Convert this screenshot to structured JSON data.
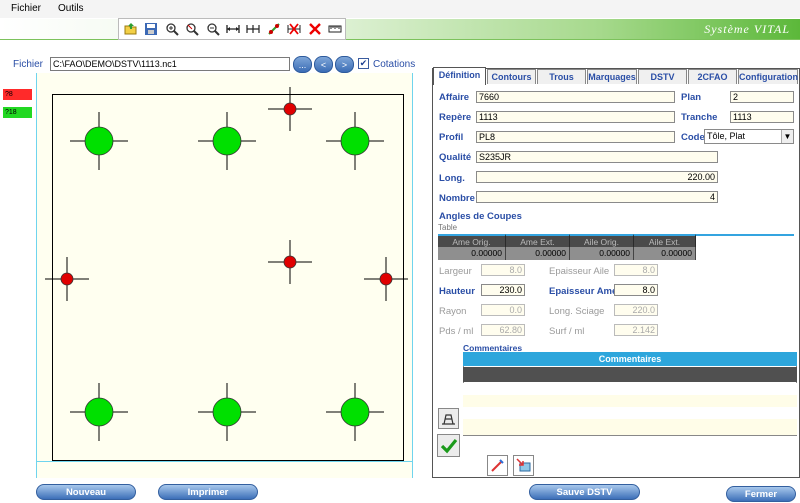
{
  "menubar": {
    "items": [
      "Fichier",
      "Outils"
    ]
  },
  "app_title": "Système VITAL",
  "toolbar": {
    "icons": [
      "folder-open-icon",
      "save-icon",
      "zoom-in-icon",
      "zoom-select-icon",
      "zoom-out-icon",
      "dimension-h-icon",
      "dimension-hh-icon",
      "add-point-icon",
      "delete-dimension-icon",
      "measure-icon"
    ]
  },
  "file": {
    "label": "Fichier",
    "path": "C:\\FAO\\DEMO\\DSTV\\1113.nc1",
    "browse_label": "...",
    "prev_label": "<",
    "next_label": ">"
  },
  "cotations": {
    "label": "Cotations",
    "checked": true,
    "check_glyph": "✔"
  },
  "left_badges": [
    {
      "text": "?8",
      "color": "#ff2a2a"
    },
    {
      "text": "?18",
      "color": "#22d822"
    }
  ],
  "drawing": {
    "holes_large_color": "#00e000",
    "holes_small_color": "#e00000"
  },
  "tabs": [
    "Définition",
    "Contours",
    "Trous",
    "Marquages",
    "DSTV",
    "2CFAO",
    "Configuration"
  ],
  "active_tab": "Définition",
  "form": {
    "affaire": {
      "label": "Affaire",
      "value": "7660"
    },
    "plan": {
      "label": "Plan",
      "value": "2"
    },
    "repere": {
      "label": "Repère",
      "value": "1113"
    },
    "tranche": {
      "label": "Tranche",
      "value": "1113"
    },
    "profil": {
      "label": "Profil",
      "value": "PL8"
    },
    "code": {
      "label": "Code",
      "value": "Tôle, Plat",
      "arrow": "▼"
    },
    "qualite": {
      "label": "Qualité",
      "value": "S235JR"
    },
    "long": {
      "label": "Long.",
      "value": "220.00"
    },
    "nombre": {
      "label": "Nombre",
      "value": "4"
    },
    "angles_title": "Angles de Coupes",
    "table_caption": "Table",
    "angles_headers": [
      "Ame Orig.",
      "Ame Ext.",
      "Aile Orig.",
      "Aile Ext."
    ],
    "angles_values": [
      "0.00000",
      "0.00000",
      "0.00000",
      "0.00000"
    ],
    "largeur": {
      "label": "Largeur",
      "value": "8.0"
    },
    "ep_aile": {
      "label": "Epaisseur Aile",
      "value": "8.0"
    },
    "hauteur": {
      "label": "Hauteur",
      "value": "230.0"
    },
    "ep_ame": {
      "label": "Epaisseur Ame",
      "value": "8.0"
    },
    "rayon": {
      "label": "Rayon",
      "value": "0.0"
    },
    "long_sciage": {
      "label": "Long. Sciage",
      "value": "220.0"
    },
    "pds_ml": {
      "label": "Pds / ml",
      "value": "62.80"
    },
    "surf_ml": {
      "label": "Surf / ml",
      "value": "2.142"
    }
  },
  "commentaires": {
    "section_label": "Commentaires",
    "column_header": "Commentaires"
  },
  "buttons": {
    "nouveau": "Nouveau",
    "imprimer": "Imprimer",
    "sauve_dstv": "Sauve DSTV",
    "fermer": "Fermer"
  }
}
